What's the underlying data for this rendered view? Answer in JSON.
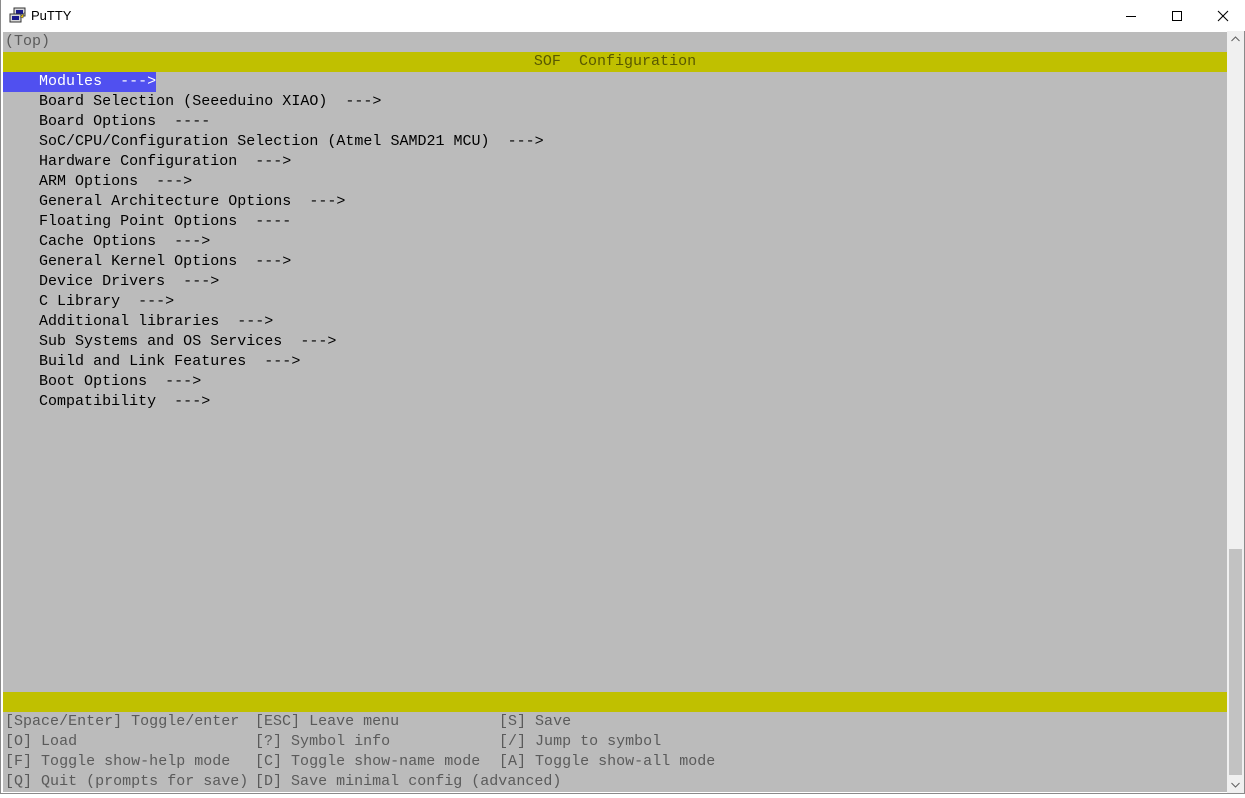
{
  "window": {
    "title": "PuTTY",
    "controls": {
      "minimize": "minimize-icon",
      "maximize": "maximize-icon",
      "close": "close-icon"
    }
  },
  "terminal": {
    "breadcrumb": "(Top)",
    "header": "SOF  Configuration",
    "menu_items": [
      "Modules  --->",
      "Board Selection (Seeeduino XIAO)  --->",
      "Board Options  ----",
      "SoC/CPU/Configuration Selection (Atmel SAMD21 MCU)  --->",
      "Hardware Configuration  --->",
      "ARM Options  --->",
      "General Architecture Options  --->",
      "Floating Point Options  ----",
      "Cache Options  --->",
      "General Kernel Options  --->",
      "Device Drivers  --->",
      "C Library  --->",
      "Additional libraries  --->",
      "Sub Systems and OS Services  --->",
      "Build and Link Features  --->",
      "Boot Options  --->",
      "Compatibility  --->"
    ],
    "selected_index": 0,
    "help": [
      [
        "[Space/Enter] Toggle/enter",
        "[ESC] Leave menu",
        "[S] Save"
      ],
      [
        "[O] Load",
        "[?] Symbol info",
        "[/] Jump to symbol"
      ],
      [
        "[F] Toggle show-help mode",
        "[C] Toggle show-name mode",
        "[A] Toggle show-all mode"
      ],
      [
        "[Q] Quit (prompts for save)",
        "[D] Save minimal config (advanced)",
        ""
      ]
    ]
  },
  "colors": {
    "terminal_bg": "#bbbbbb",
    "banner": "#c0c000",
    "selection": "#5050f0"
  }
}
